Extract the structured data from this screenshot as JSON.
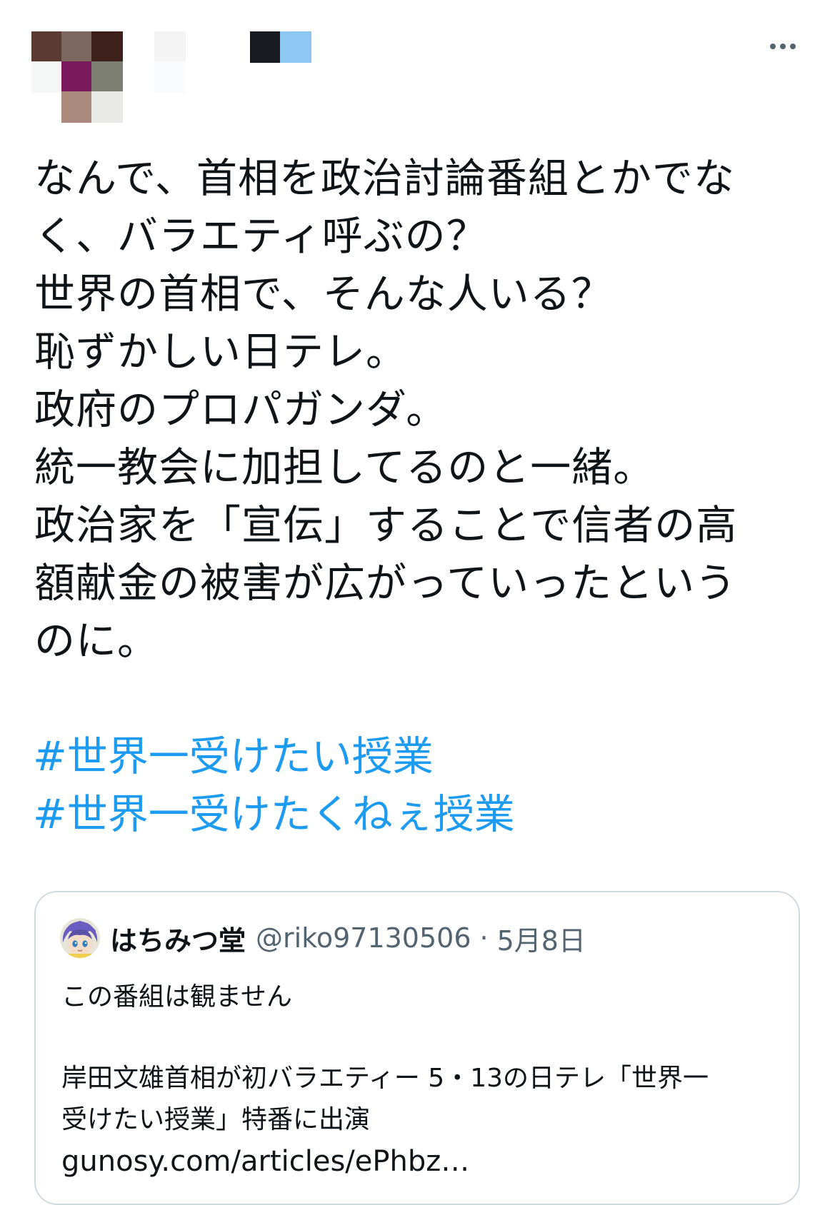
{
  "header": {
    "more_icon": "more-horizontal-icon",
    "avatar_mosaic_colors": [
      "#5a3b32",
      "#7b675e",
      "#3d2019",
      "#f5f6f6",
      "#7a1a5c",
      "#7c7f72",
      "#a98a7d",
      "#e9e9e7"
    ],
    "name_mosaic_colors": [
      "#f4f4f4",
      "#fafbfc",
      "#171a1f",
      "#8ec8f2"
    ]
  },
  "tweet": {
    "lines": [
      "なんで、首相を政治討論番組とかでな",
      "く、バラエティ呼ぶの？",
      "世界の首相で、そんな人いる？",
      "恥ずかしい日テレ。",
      "政府のプロパガンダ。",
      "統一教会に加担してるのと一緒。",
      "政治家を「宣伝」することで信者の高",
      "額献金の被害が広がっていったという",
      "のに。"
    ],
    "hashtags": [
      "#世界一受けたい授業",
      "#世界一受けたくねぇ授業"
    ],
    "hashtag_color": "#1d9bf0"
  },
  "quote": {
    "name": "はちみつ堂",
    "handle": "@riko97130506",
    "separator": "·",
    "date": "5月8日",
    "text_line1": "この番組は観ません",
    "text_line2": "岸田文雄首相が初バラエティー 5・13の日テレ「世界一",
    "text_line3": "受けたい授業」特番に出演",
    "link": "gunosy.com/articles/ePhbz…",
    "avatar_icon": "anime-avatar-icon"
  }
}
